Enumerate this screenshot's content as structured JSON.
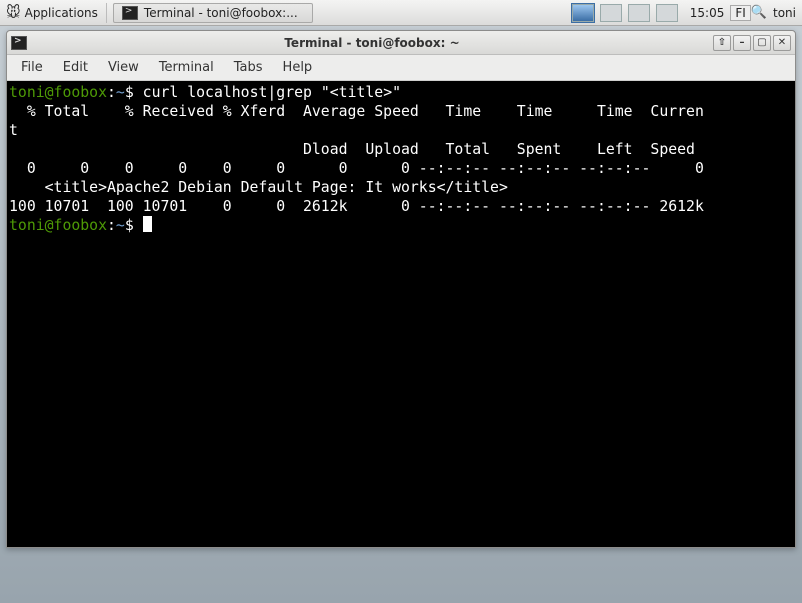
{
  "panel": {
    "applications_label": "Applications",
    "task_label": "Terminal - toni@foobox:...",
    "clock": "15:05",
    "lang": "FI",
    "user": "toni"
  },
  "window": {
    "title": "Terminal - toni@foobox: ~",
    "menu": {
      "file": "File",
      "edit": "Edit",
      "view": "View",
      "terminal": "Terminal",
      "tabs": "Tabs",
      "help": "Help"
    }
  },
  "term": {
    "prompt_user": "toni@foobox",
    "prompt_path": "~",
    "prompt_sep": ":",
    "prompt_sym": "$ ",
    "cmd": "curl localhost|grep \"<title>\"",
    "line_header1": "  % Total    % Received % Xferd  Average Speed   Time    Time     Time  Curren",
    "line_header1b": "t",
    "line_header2": "                                 Dload  Upload   Total   Spent    Left  Speed",
    "line_progress1": "  0     0    0     0    0     0      0      0 --:--:-- --:--:-- --:--:--     0",
    "line_title": "    <title>Apache2 Debian Default Page: It works</title>",
    "line_progress2": "100 10701  100 10701    0     0  2612k      0 --:--:-- --:--:-- --:--:-- 2612k"
  }
}
